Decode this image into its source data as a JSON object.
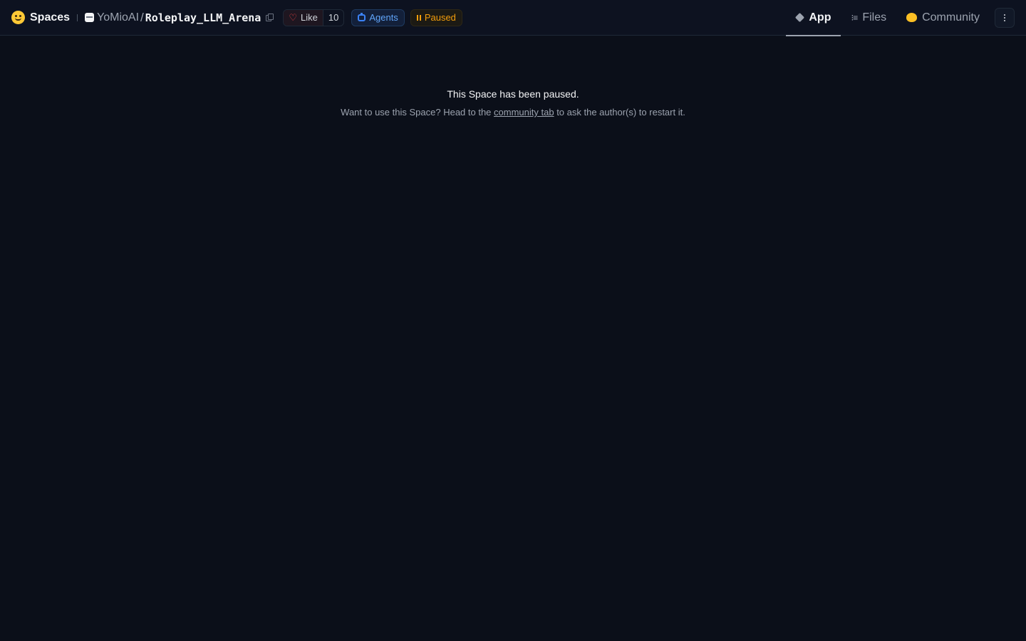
{
  "header": {
    "brand": "Spaces",
    "owner": "YoMioAI",
    "separator": "/",
    "repo": "Roleplay_LLM_Arena",
    "like_label": "Like",
    "like_count": "10",
    "agents_label": "Agents",
    "status_label": "Paused",
    "tabs": [
      {
        "label": "App",
        "icon": "cube-icon",
        "active": true
      },
      {
        "label": "Files",
        "icon": "files-icon",
        "active": false
      },
      {
        "label": "Community",
        "icon": "community-icon",
        "active": false
      }
    ]
  },
  "main": {
    "title": "This Space has been paused.",
    "message_prefix": "Want to use this Space? Head to the ",
    "message_link": "community tab",
    "message_suffix": " to ask the author(s) to restart it."
  },
  "colors": {
    "background": "#0b0f19",
    "accent_blue": "#60a5fa",
    "accent_amber": "#f59e0b",
    "like_heart": "#ef4444"
  }
}
